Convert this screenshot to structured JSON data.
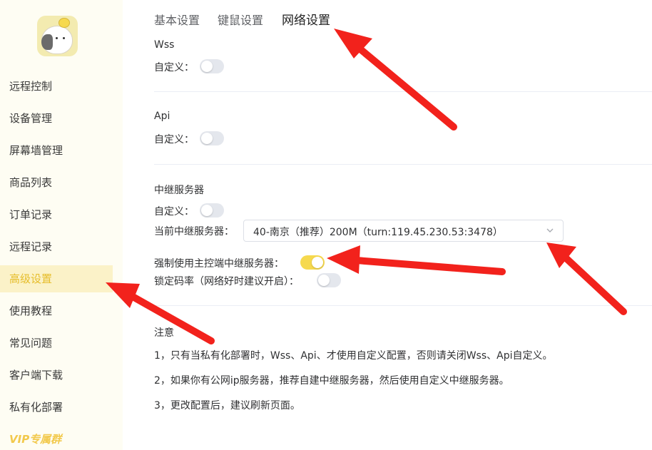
{
  "sidebar": {
    "items": [
      {
        "label": "远程控制"
      },
      {
        "label": "设备管理"
      },
      {
        "label": "屏幕墙管理"
      },
      {
        "label": "商品列表"
      },
      {
        "label": "订单记录"
      },
      {
        "label": "远程记录"
      },
      {
        "label": "高级设置"
      },
      {
        "label": "使用教程"
      },
      {
        "label": "常见问题"
      },
      {
        "label": "客户端下载"
      },
      {
        "label": "私有化部署"
      },
      {
        "label": "VIP专属群"
      }
    ],
    "active_item": "高级设置"
  },
  "tabs": [
    {
      "label": "基本设置"
    },
    {
      "label": "键鼠设置"
    },
    {
      "label": "网络设置"
    }
  ],
  "active_tab": "网络设置",
  "wss": {
    "title": "Wss",
    "custom_label": "自定义：",
    "custom_enabled": false
  },
  "api": {
    "title": "Api",
    "custom_label": "自定义：",
    "custom_enabled": false
  },
  "relay": {
    "title": "中继服务器",
    "custom_label": "自定义：",
    "custom_enabled": false,
    "current_label": "当前中继服务器：",
    "current_value": "40-南京（推荐）200M（turn:119.45.230.53:3478）",
    "force_label": "强制使用主控端中继服务器：",
    "force_enabled": true,
    "lock_bitrate_label": "锁定码率（网络好时建议开启）：",
    "lock_bitrate_enabled": false
  },
  "notes": {
    "title": "注意",
    "lines": [
      "1，只有当私有化部署时，Wss、Api、才使用自定义配置，否则请关闭Wss、Api自定义。",
      "2，如果你有公网ip服务器，推荐自建中继服务器，然后使用自定义中继服务器。",
      "3，更改配置后，建议刷新页面。"
    ]
  },
  "colors": {
    "accent": "#f6d94e",
    "active_text": "#e6bd2a",
    "annotation_arrow": "#f2221c",
    "sidebar_bg": "#fefdf3"
  }
}
